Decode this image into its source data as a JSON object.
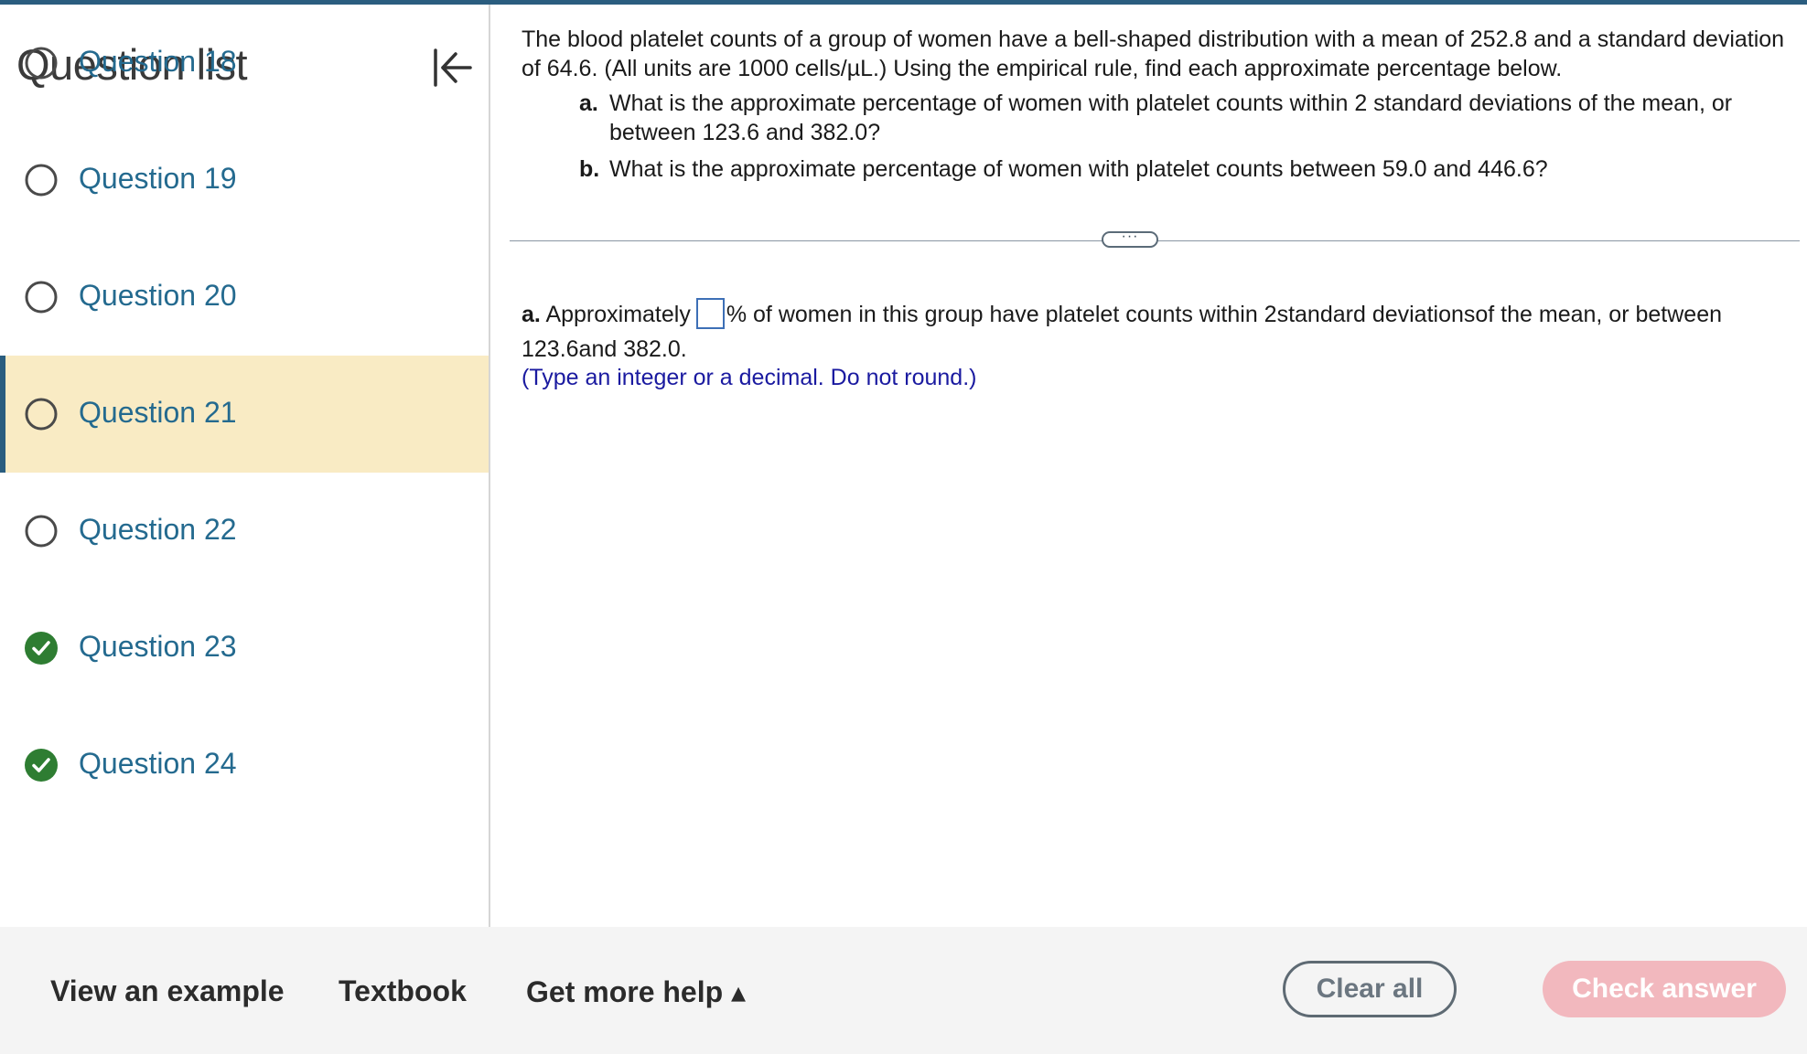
{
  "sidebar": {
    "title": "Question list",
    "items": [
      {
        "label": "Question 18",
        "status": "partial"
      },
      {
        "label": "Question 19",
        "status": "unanswered"
      },
      {
        "label": "Question 20",
        "status": "unanswered"
      },
      {
        "label": "Question 21",
        "status": "unanswered",
        "active": true
      },
      {
        "label": "Question 22",
        "status": "unanswered"
      },
      {
        "label": "Question 23",
        "status": "complete"
      },
      {
        "label": "Question 24",
        "status": "complete"
      }
    ]
  },
  "problem": {
    "intro": "The blood platelet counts of a group of women have a bell-shaped distribution with a mean of 252.8 and a standard deviation of 64.6. (All units are 1000 cells/µL.) Using the empirical rule, find each approximate percentage below.",
    "parts": [
      {
        "letter": "a.",
        "text": "What is the approximate percentage of women with platelet counts within 2 standard deviations of the mean, or between 123.6 and 382.0?"
      },
      {
        "letter": "b.",
        "text": "What is the approximate percentage of women with platelet counts between 59.0 and 446.6?"
      }
    ]
  },
  "answer": {
    "letter": "a.",
    "prefix": "Approximately",
    "suffix": "% of women in this group have platelet counts within 2standard deviationsof the mean, or between 123.6and 382.0.",
    "value": "",
    "hint": "(Type an integer or a decimal. Do not round.)"
  },
  "more_button": "···",
  "footer": {
    "view_example": "View an example",
    "textbook": "Textbook",
    "get_more_help": "Get more help ▴",
    "clear_all": "Clear all",
    "check_answer": "Check answer"
  },
  "colors": {
    "accent": "#2a5d7f",
    "link": "#246a8f",
    "active_row": "#f9ebc4",
    "complete": "#2e7d32",
    "check_disabled": "#f2b8be"
  }
}
